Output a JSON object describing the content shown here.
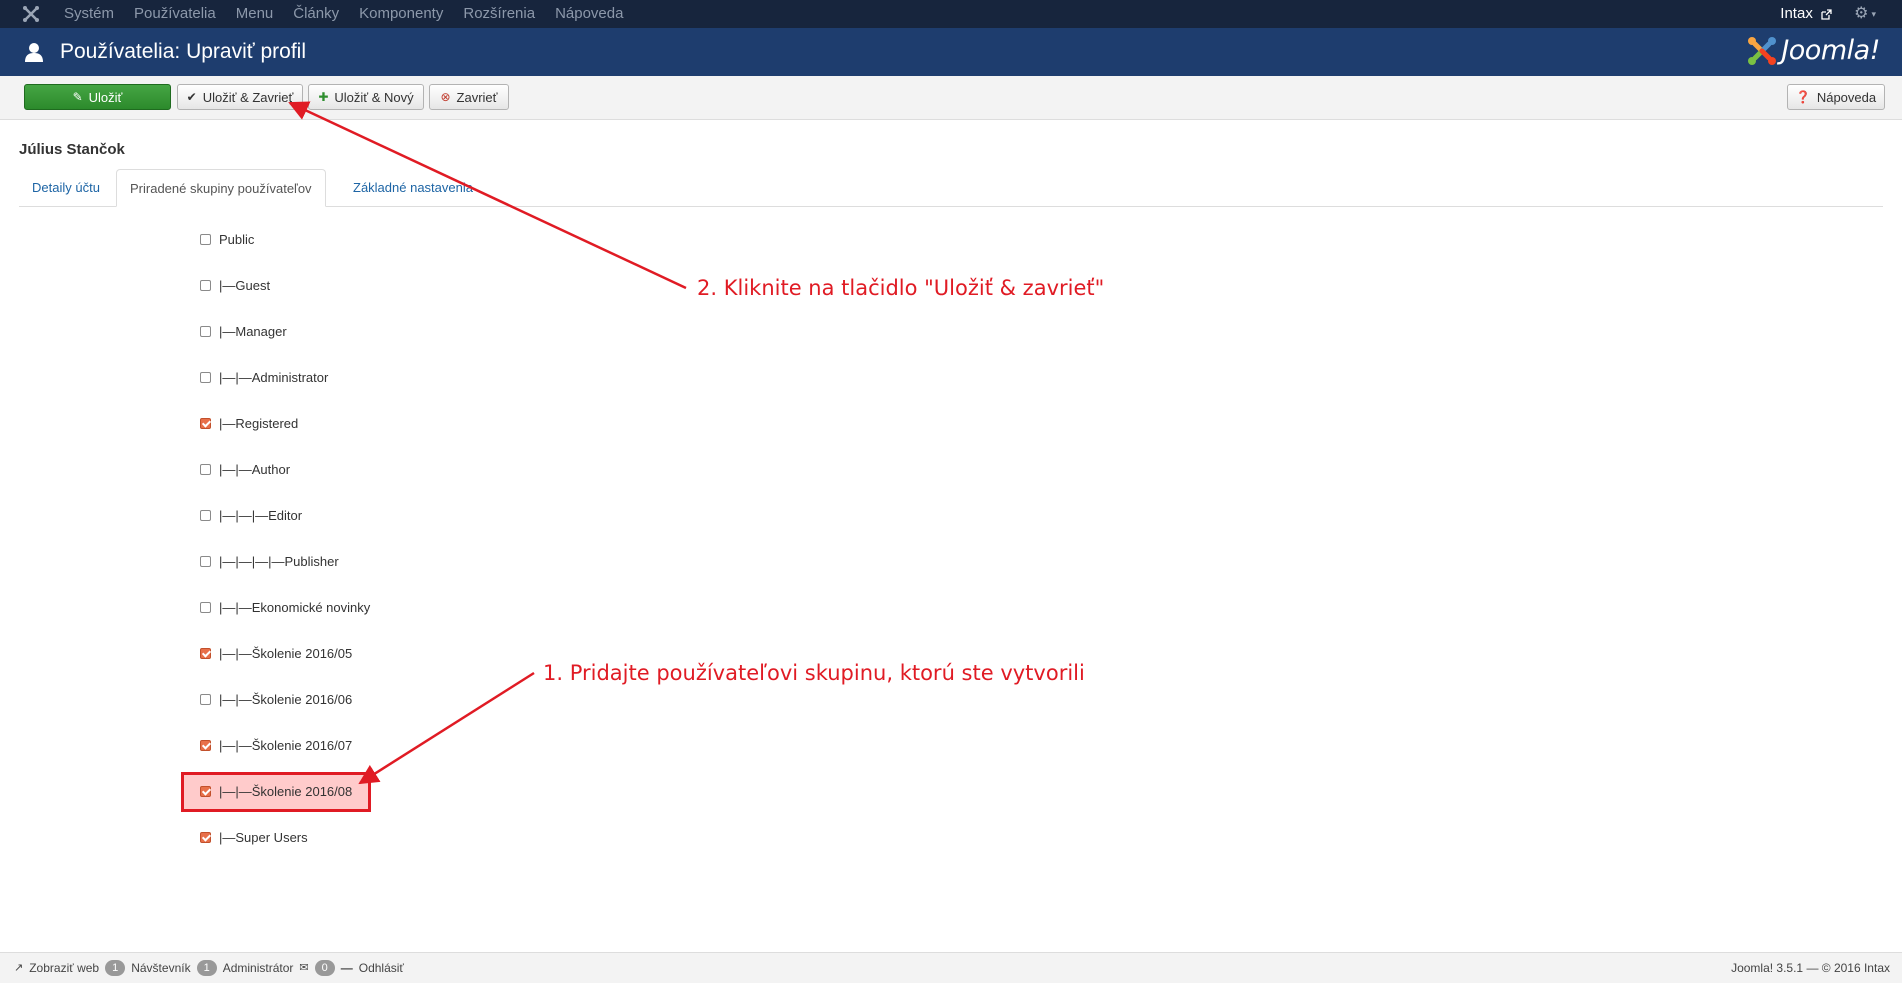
{
  "nav": {
    "menu": [
      "Systém",
      "Používatelia",
      "Menu",
      "Články",
      "Komponenty",
      "Rozšírenia",
      "Nápoveda"
    ],
    "user": "Intax"
  },
  "header": {
    "title": "Používatelia: Upraviť profil",
    "brand": "Joomla!"
  },
  "toolbar": {
    "save": "Uložiť",
    "save_close": "Uložiť & Zavrieť",
    "save_new": "Uložiť & Nový",
    "close": "Zavrieť",
    "help": "Nápoveda"
  },
  "user_name": "Július Stančok",
  "tabs": [
    "Detaily účtu",
    "Priradené skupiny používateľov",
    "Základné nastavenia"
  ],
  "groups": [
    {
      "label": "Public",
      "checked": false
    },
    {
      "label": "|—Guest",
      "checked": false
    },
    {
      "label": "|—Manager",
      "checked": false
    },
    {
      "label": "|—|—Administrator",
      "checked": false
    },
    {
      "label": "|—Registered",
      "checked": true
    },
    {
      "label": "|—|—Author",
      "checked": false
    },
    {
      "label": "|—|—|—Editor",
      "checked": false
    },
    {
      "label": "|—|—|—|—Publisher",
      "checked": false
    },
    {
      "label": "|—|—Ekonomické novinky",
      "checked": false
    },
    {
      "label": "|—|—Školenie 2016/05",
      "checked": true
    },
    {
      "label": "|—|—Školenie 2016/06",
      "checked": false
    },
    {
      "label": "|—|—Školenie 2016/07",
      "checked": true
    },
    {
      "label": "|—|—Školenie 2016/08",
      "checked": true
    },
    {
      "label": "|—Super Users",
      "checked": true
    }
  ],
  "annotations": {
    "step1": "1. Pridajte používateľovi skupinu, ktorú ste vytvorili",
    "step2": "2. Kliknite na tlačidlo \"Uložiť & zavrieť\""
  },
  "footer": {
    "view_site": "Zobraziť web",
    "visitors_count": "1",
    "visitors_label": "Návštevník",
    "admins_count": "1",
    "admins_label": "Administrátor",
    "messages_count": "0",
    "logout": "Odhlásiť",
    "version": "Joomla! 3.5.1 — © 2016 Intax"
  },
  "colors": {
    "navbar": "#17253d",
    "header": "#1e3d6e",
    "save": "#2f8f2f",
    "annotation": "#e01b24",
    "checked": "#e8704a"
  }
}
